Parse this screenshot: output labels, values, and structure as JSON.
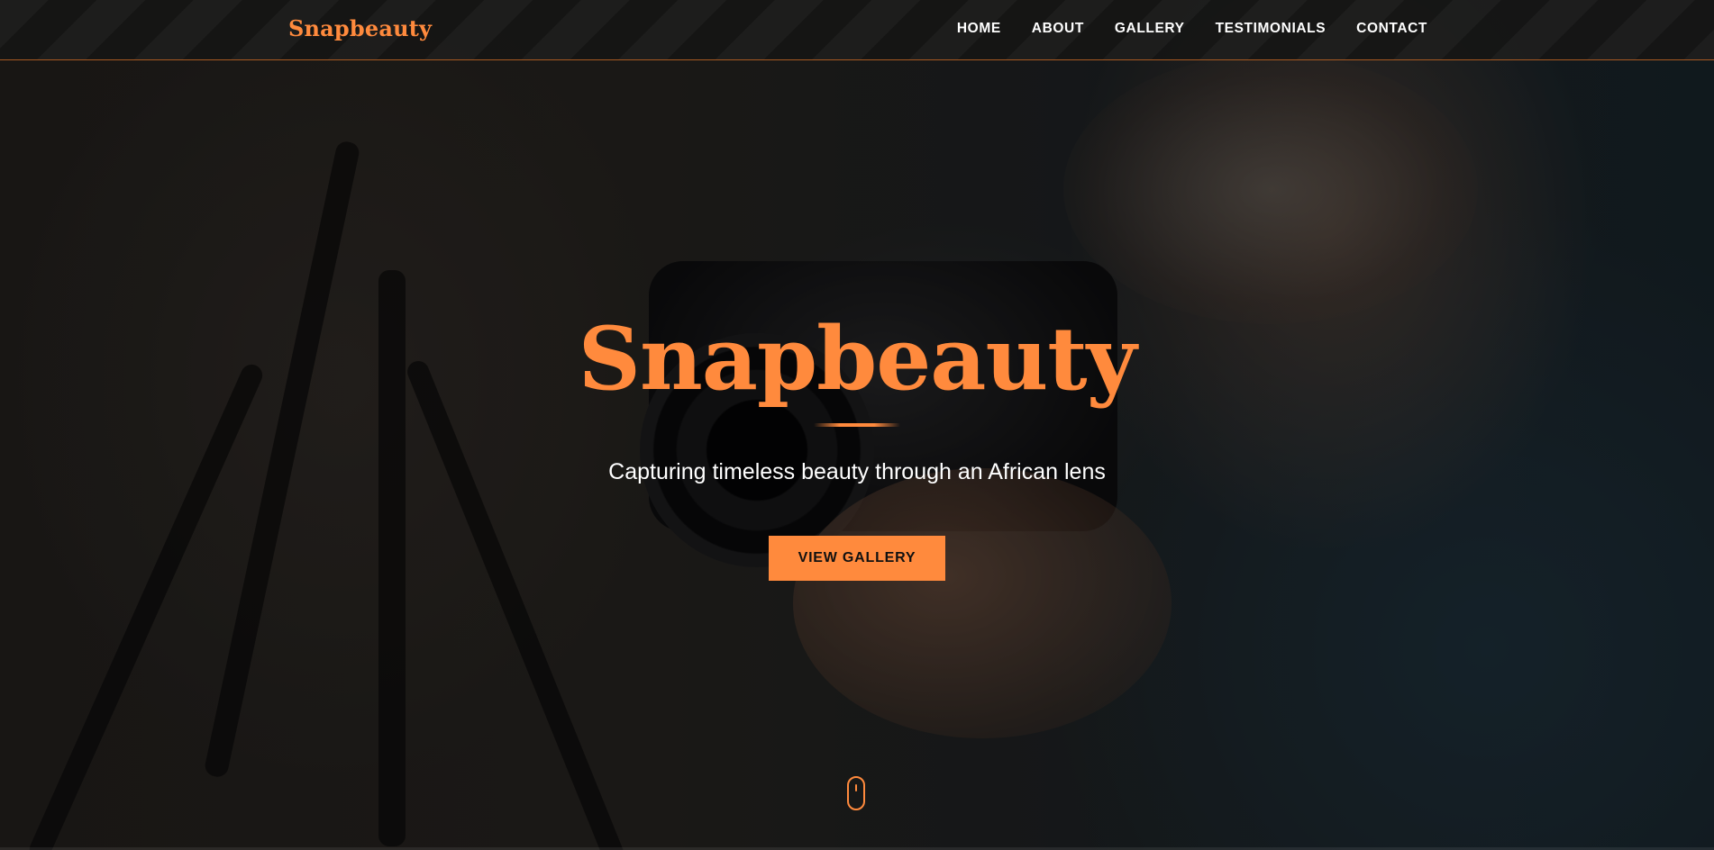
{
  "navbar": {
    "brand": "Snapbeauty",
    "links": [
      {
        "label": "HOME"
      },
      {
        "label": "ABOUT"
      },
      {
        "label": "GALLERY"
      },
      {
        "label": "TESTIMONIALS"
      },
      {
        "label": "CONTACT"
      }
    ]
  },
  "hero": {
    "title": "Snapbeauty",
    "subtitle": "Capturing timeless beauty through an African lens",
    "cta_label": "VIEW GALLERY"
  },
  "scroll": {
    "icon": "mouse-scroll-icon"
  },
  "colors": {
    "accent": "#ff8a3d",
    "navbar_bg": "#161514",
    "text": "#ffffff"
  }
}
